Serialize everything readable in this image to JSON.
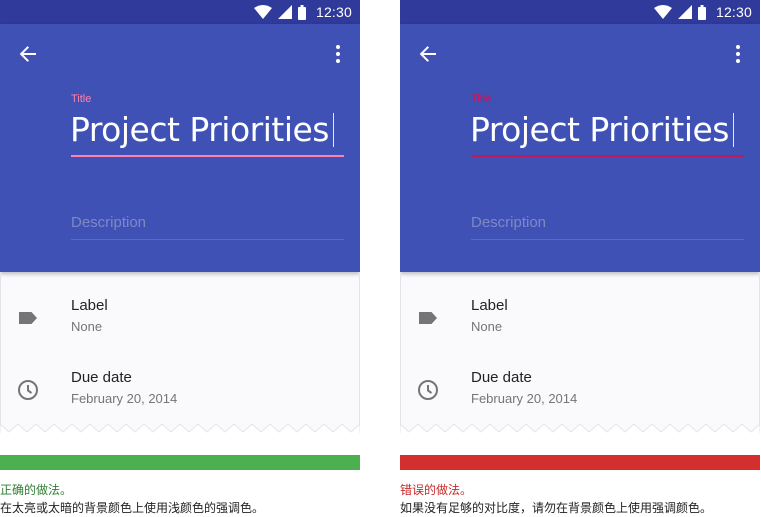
{
  "colors": {
    "status_bar": "#2f3a9a",
    "app_bar": "#3f51b5",
    "good_accent": "#ff80ab",
    "bad_accent": "#c2185b",
    "good_bar": "#4caf50",
    "bad_bar": "#d32f2f",
    "good_text": "#2e7d32",
    "bad_text": "#c62828",
    "icon_gray": "#757575"
  },
  "status_bar": {
    "time": "12:30",
    "icons": [
      "wifi-icon",
      "signal-icon",
      "battery-icon"
    ]
  },
  "examples": [
    {
      "id": "correct",
      "title_field": {
        "label": "Title",
        "value": "Project Priorities"
      },
      "description_field": {
        "placeholder": "Description"
      },
      "items": [
        {
          "icon": "label-tag-icon",
          "primary": "Label",
          "secondary": "None"
        },
        {
          "icon": "clock-icon",
          "primary": "Due date",
          "secondary": "February 20, 2014"
        }
      ],
      "verdict": {
        "title": "正确的做法。",
        "description": "在太亮或太暗的背景颜色上使用浅颜色的强调色。"
      }
    },
    {
      "id": "incorrect",
      "title_field": {
        "label": "Title",
        "value": "Project Priorities"
      },
      "description_field": {
        "placeholder": "Description"
      },
      "items": [
        {
          "icon": "label-tag-icon",
          "primary": "Label",
          "secondary": "None"
        },
        {
          "icon": "clock-icon",
          "primary": "Due date",
          "secondary": "February 20, 2014"
        }
      ],
      "verdict": {
        "title": "错误的做法。",
        "description": "如果没有足够的对比度，请勿在背景颜色上使用强调颜色。"
      }
    }
  ]
}
